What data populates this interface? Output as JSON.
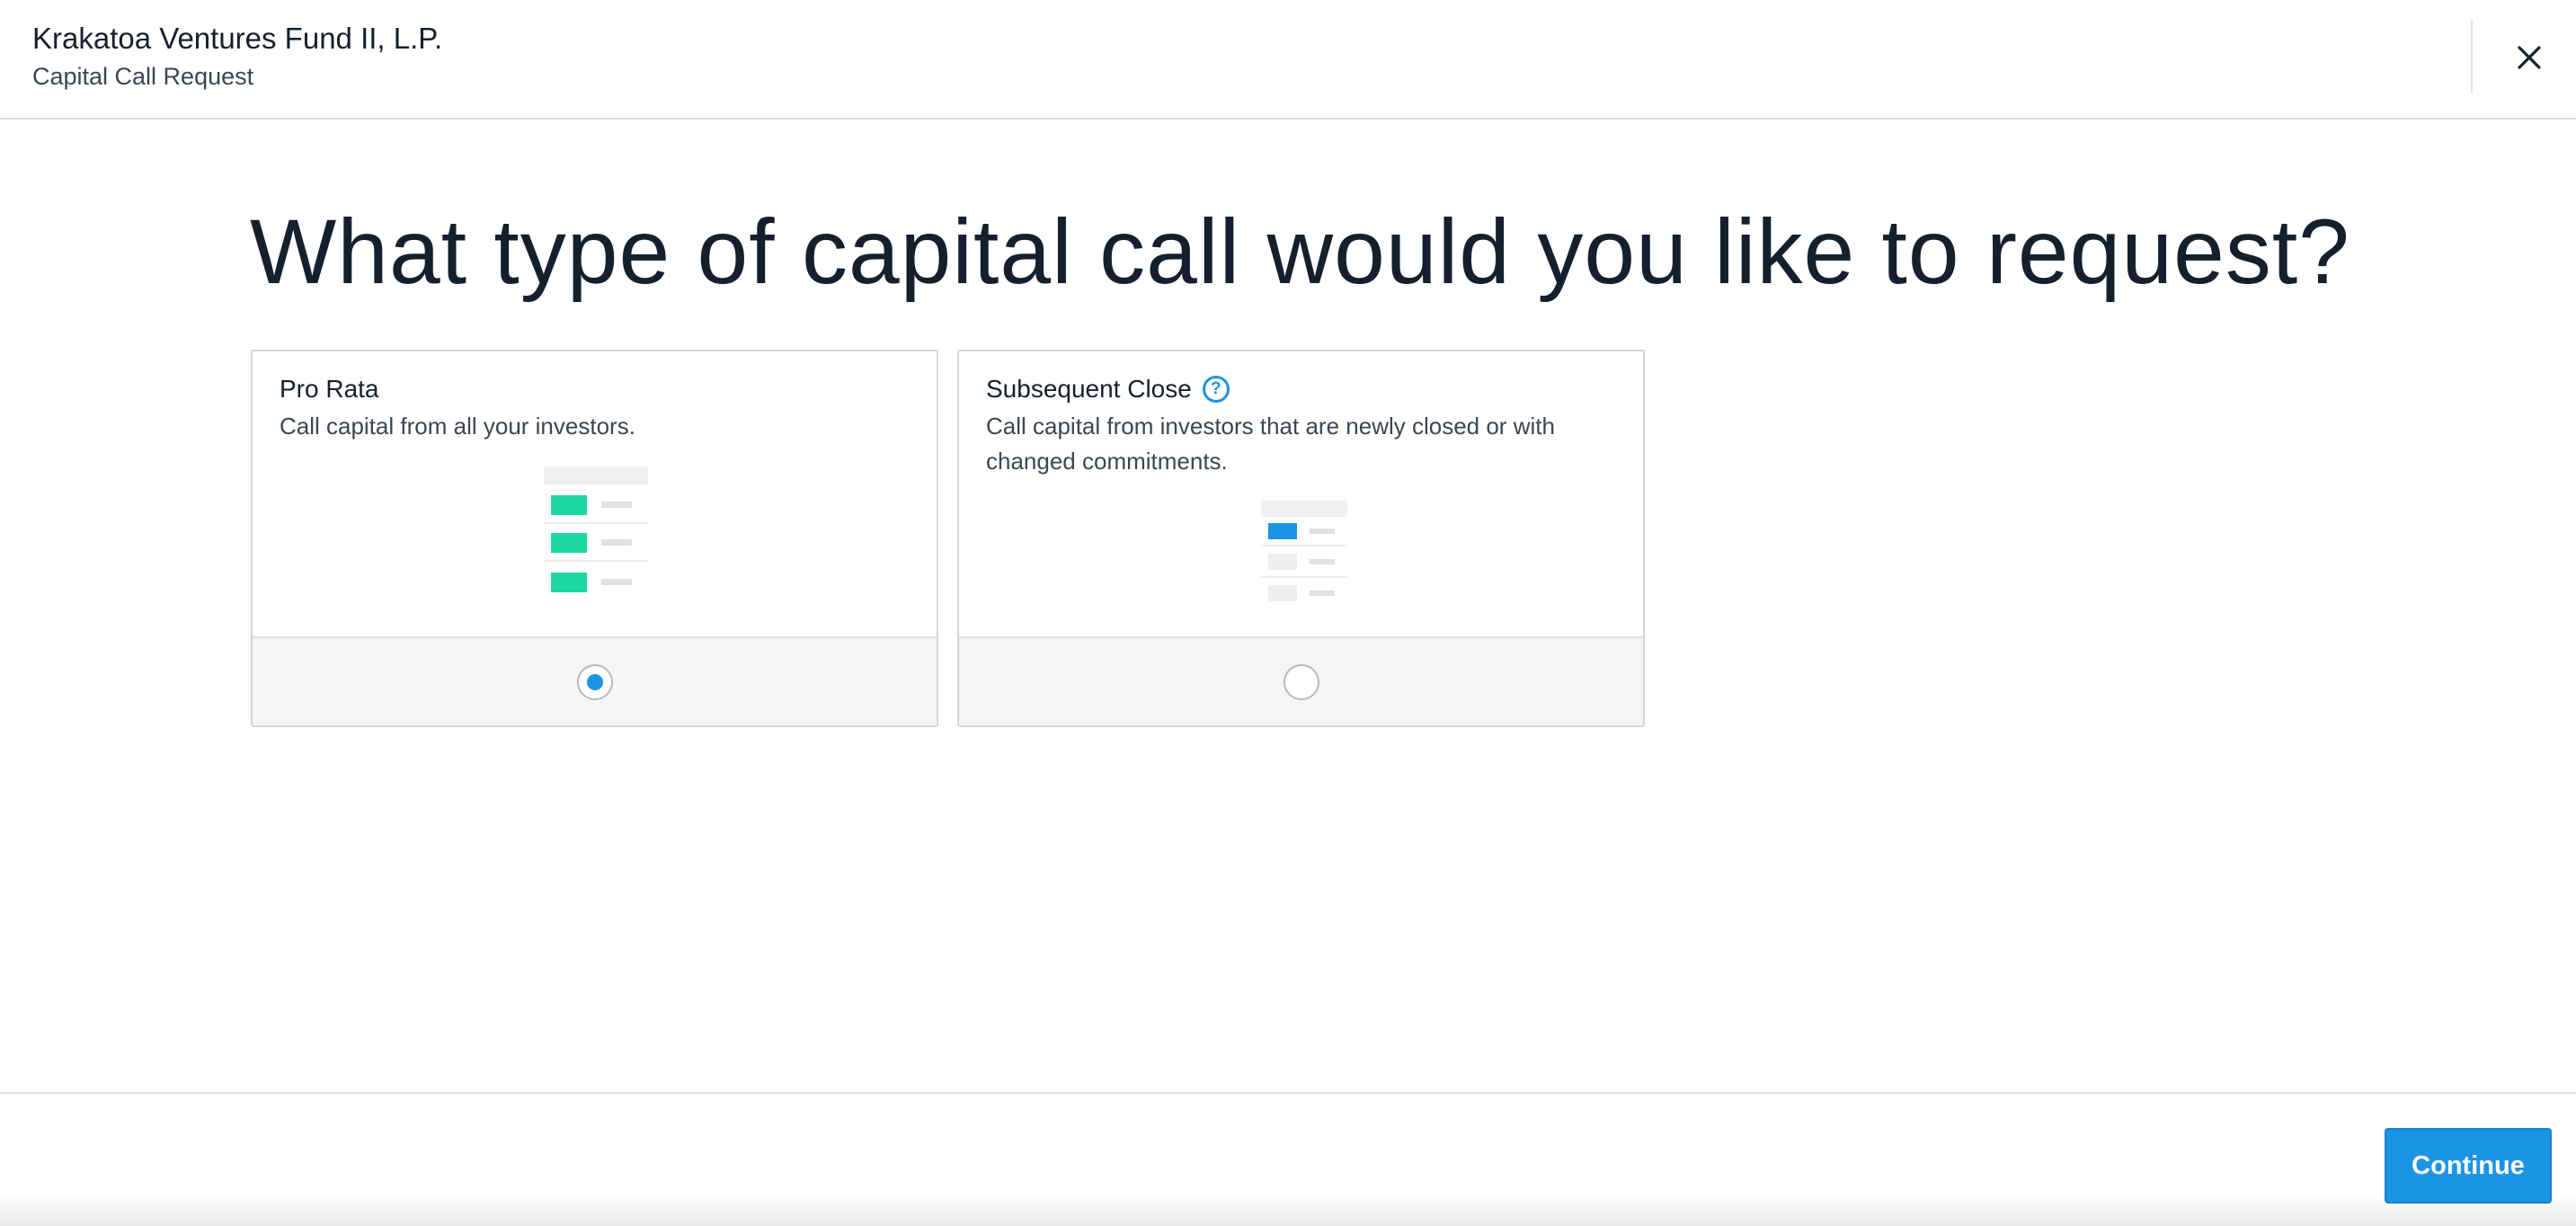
{
  "header": {
    "fund_name": "Krakatoa Ventures Fund II, L.P.",
    "subtitle": "Capital Call Request",
    "close_icon": "close-icon"
  },
  "main": {
    "question": "What type of capital call would you like to request?",
    "options": [
      {
        "title": "Pro Rata",
        "description": "Call capital from all your investors.",
        "selected": true,
        "accent_color": "#1dd6a2"
      },
      {
        "title": "Subsequent Close",
        "description": "Call capital from investors that are newly closed or with changed commitments.",
        "selected": false,
        "help_icon": "question-circle-icon",
        "accent_color": "#1b94e6"
      }
    ]
  },
  "footer": {
    "continue_label": "Continue"
  },
  "colors": {
    "primary": "#1b94e6",
    "text": "#14202e",
    "muted_text": "#3b4652"
  }
}
